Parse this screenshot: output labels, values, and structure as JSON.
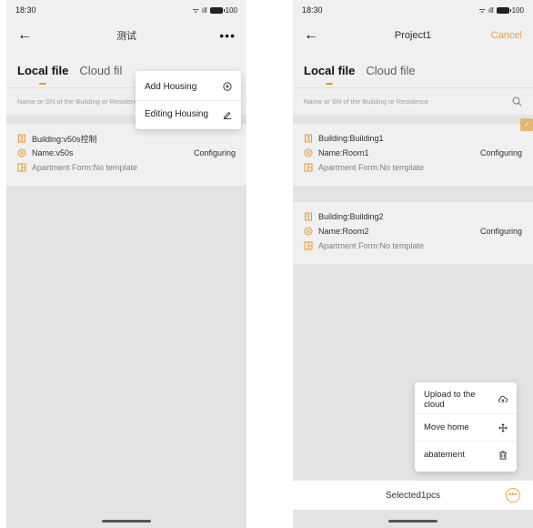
{
  "left": {
    "status": {
      "time": "18:30",
      "battery": "100"
    },
    "nav": {
      "title": "测试"
    },
    "tabs": [
      "Local file",
      "Cloud fil"
    ],
    "search": {
      "placeholder": "Name or SN of the Building or Residence"
    },
    "card": {
      "building": "Building:v50s控制",
      "name": "Name:v50s",
      "status": "Configuring",
      "apartment": "Apartment Form:No template"
    },
    "menu": {
      "items": [
        "Add Housing",
        "Editing Housing"
      ]
    }
  },
  "right": {
    "status": {
      "time": "18:30",
      "battery": "100"
    },
    "nav": {
      "title": "Project1",
      "cancel": "Cancel"
    },
    "tabs": [
      "Local file",
      "Cloud file"
    ],
    "search": {
      "placeholder": "Name or SN of the Building or Residence"
    },
    "cards": [
      {
        "building": "Building:Building1",
        "name": "Name:Room1",
        "status": "Configuring",
        "apartment": "Apartment Form:No template"
      },
      {
        "building": "Building:Building2",
        "name": "Name:Room2",
        "status": "Configuring",
        "apartment": "Apartment Form:No template"
      }
    ],
    "popup": {
      "items": [
        "Upload to the cloud",
        "Move home",
        "abatement"
      ]
    },
    "bottom": {
      "selected": "Selected1pcs"
    }
  },
  "colors": {
    "accent": "#f0a23b"
  },
  "icons": [
    "back-arrow-icon",
    "more-icon",
    "search-icon",
    "building-icon",
    "name-icon",
    "apartment-icon",
    "plus-circle-icon",
    "pencil-icon",
    "cloud-upload-icon",
    "move-icon",
    "trash-icon",
    "check-icon"
  ]
}
